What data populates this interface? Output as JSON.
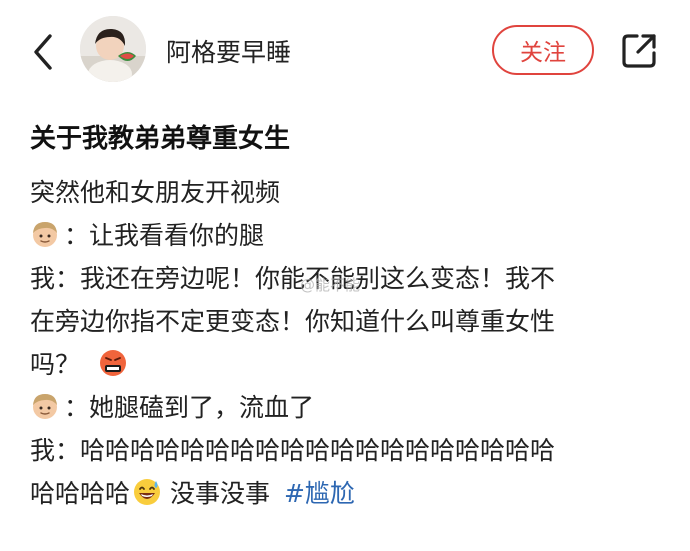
{
  "header": {
    "username": "阿格要早睡",
    "follow_label": "关注"
  },
  "post": {
    "title": "关于我教弟弟尊重女生",
    "lines": [
      "突然他和女朋友开视频",
      "：让我看看你的腿",
      "我：我还在旁边呢！你能不能别这么变态！我不",
      "在旁边你指不定更变态！你知道什么叫尊重女性",
      "吗？",
      "：她腿磕到了，流血了",
      "我：哈哈哈哈哈哈哈哈哈哈哈哈哈哈哈哈哈哈哈",
      "哈哈哈哈",
      "没事没事"
    ],
    "hashtag": "#尴尬",
    "watermark": "@能不能"
  },
  "icons": {
    "back": "chevron-left-icon",
    "share": "share-icon",
    "boy": "boy-face-emoji",
    "angry": "cursing-face-emoji",
    "sweat": "grinning-sweat-emoji"
  },
  "colors": {
    "accent": "#e0443e",
    "hashtag": "#2d67b2"
  }
}
